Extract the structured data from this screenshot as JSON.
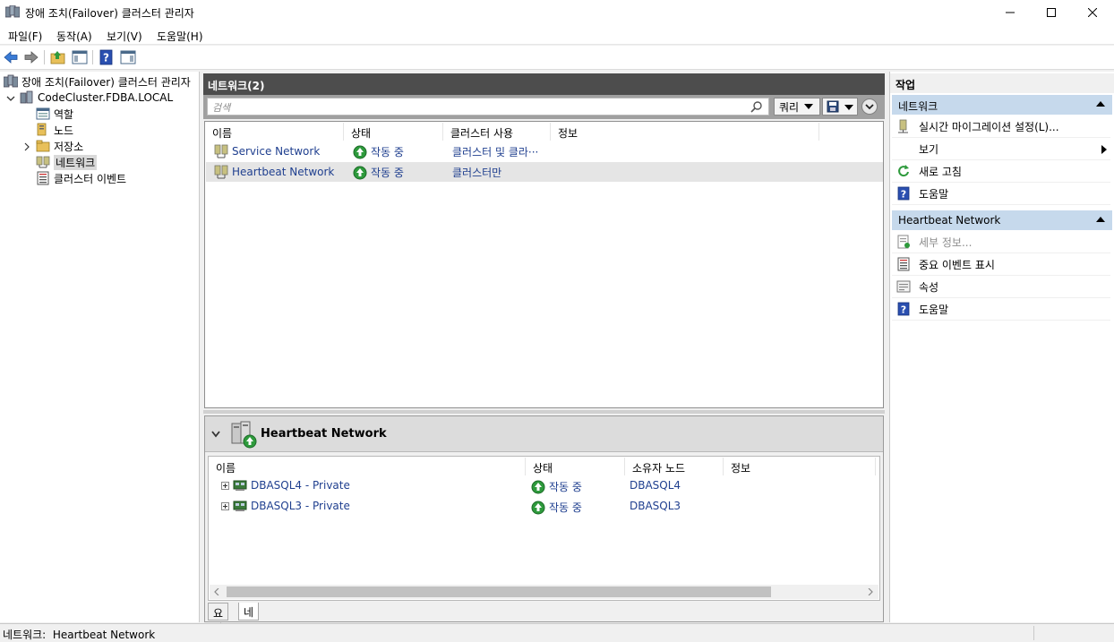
{
  "window": {
    "title": "장애 조치(Failover) 클러스터 관리자",
    "controls": [
      "minimize-icon",
      "maximize-icon",
      "close-icon"
    ]
  },
  "menu": [
    "파일(F)",
    "동작(A)",
    "보기(V)",
    "도움말(H)"
  ],
  "toolbar": [
    "back-arrow-icon",
    "forward-arrow-icon",
    "up-folder-icon",
    "show-hide-console-tree-icon",
    "help-icon",
    "show-hide-action-pane-icon"
  ],
  "tree": {
    "root": "장애 조치(Failover) 클러스터 관리자",
    "cluster": "CodeCluster.FDBA.LOCAL",
    "children": [
      "역할",
      "노드",
      "저장소",
      "네트워크",
      "클러스터 이벤트"
    ],
    "selected": "네트워크"
  },
  "center": {
    "header": "네트워크(2)",
    "search_placeholder": "검색",
    "query_label": "쿼리",
    "columns": [
      "이름",
      "상태",
      "클러스터 사용",
      "정보"
    ],
    "rows": [
      {
        "name": "Service Network",
        "status": "작동 중",
        "usage": "클러스터 및 클라···",
        "info": ""
      },
      {
        "name": "Heartbeat Network",
        "status": "작동 중",
        "usage": "클러스터만",
        "info": ""
      }
    ],
    "selected_row": 1
  },
  "detail": {
    "title": "Heartbeat Network",
    "columns": [
      "이름",
      "상태",
      "소유자 노드",
      "정보"
    ],
    "rows": [
      {
        "name": "DBASQL4 - Private",
        "status": "작동 중",
        "owner": "DBASQL4",
        "info": ""
      },
      {
        "name": "DBASQL3 - Private",
        "status": "작동 중",
        "owner": "DBASQL3",
        "info": ""
      }
    ],
    "tabs": [
      "요약",
      "네트워크 연결"
    ],
    "active_tab": "네트워크 연결"
  },
  "actions": {
    "title": "작업",
    "groups": [
      {
        "header": "네트워크",
        "items": [
          {
            "label": "실시간 마이그레이션 설정(L)...",
            "icon": "live-migration-icon"
          },
          {
            "label": "보기",
            "icon": "",
            "submenu": true
          },
          {
            "label": "새로 고침",
            "icon": "refresh-icon"
          },
          {
            "label": "도움말",
            "icon": "help-icon"
          }
        ]
      },
      {
        "header": "Heartbeat Network",
        "items": [
          {
            "label": "세부 정보...",
            "icon": "details-icon",
            "disabled": true
          },
          {
            "label": "중요 이벤트 표시",
            "icon": "critical-events-icon"
          },
          {
            "label": "속성",
            "icon": "properties-icon"
          },
          {
            "label": "도움말",
            "icon": "help-icon"
          }
        ]
      }
    ]
  },
  "status": "네트워크:  Heartbeat Network",
  "colors": {
    "panel_header": "#4d4d4d",
    "action_header": "#c6d9ec",
    "selection": "#e5e5e5",
    "status_green": "#2e9a3c",
    "link_blue": "#1f3f8f"
  }
}
